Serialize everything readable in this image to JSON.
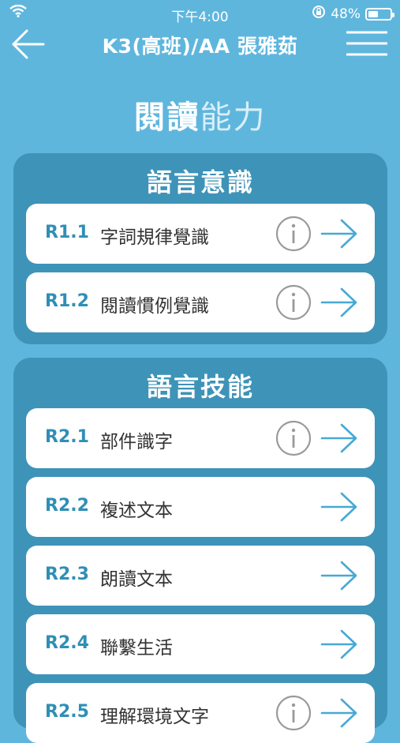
{
  "status": {
    "time": "下午4:00",
    "battery": "48%",
    "battery_level": 0.48
  },
  "header": {
    "title": "K3(高班)/AA 張雅茹"
  },
  "page_title": {
    "part1": "閱讀",
    "part2": "能力"
  },
  "sections": [
    {
      "title": "語言意識",
      "items": [
        {
          "code": "R1.1",
          "name": "字詞規律覺識"
        },
        {
          "code": "R1.2",
          "name": "閱讀慣例覺識"
        }
      ]
    },
    {
      "title": "語言技能",
      "items": [
        {
          "code": "R2.1",
          "name": "部件識字"
        },
        {
          "code": "R2.2",
          "name": "複述文本"
        },
        {
          "code": "R2.3",
          "name": "朗讀文本"
        },
        {
          "code": "R2.4",
          "name": "聯繫生活"
        },
        {
          "code": "R2.5",
          "name": "理解環境文字"
        }
      ]
    }
  ],
  "colors": {
    "background": "#5fb6dd",
    "card": "#3e93b8",
    "accent": "#2f8fb6",
    "arrow": "#47a9d4"
  }
}
